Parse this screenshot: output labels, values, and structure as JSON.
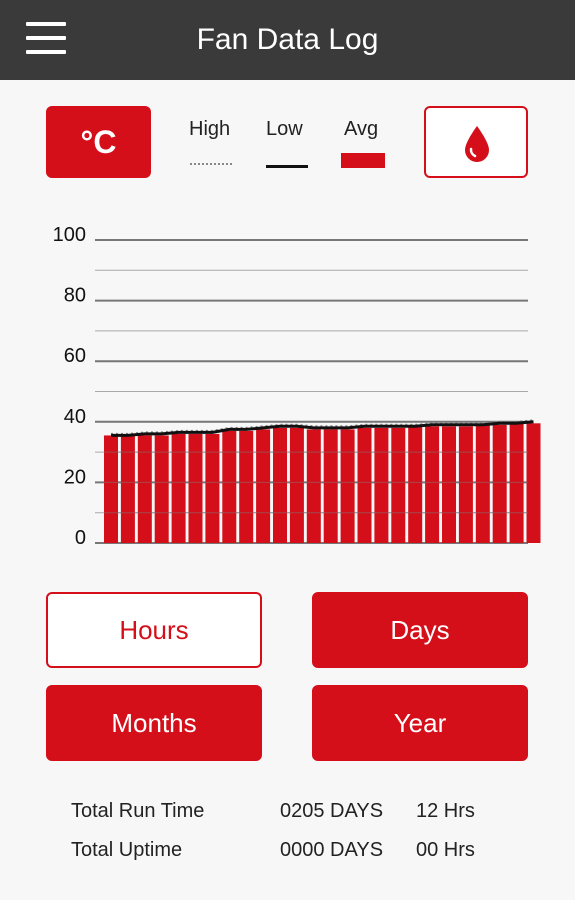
{
  "appbar": {
    "title": "Fan Data Log"
  },
  "controls": {
    "unit_label": "°C",
    "humidity_icon": "water-drop-icon"
  },
  "legend": {
    "high": "High",
    "low": "Low",
    "avg": "Avg"
  },
  "colors": {
    "accent": "#d50f1a",
    "appbar": "#3a3a3a",
    "background": "#f7f7f7"
  },
  "chart_data": {
    "type": "bar",
    "ylim": [
      0,
      100
    ],
    "yticks": [
      0,
      20,
      40,
      60,
      80,
      100
    ],
    "grid": true,
    "series": [
      {
        "name": "Avg",
        "style": "bar",
        "values": [
          35.5,
          35.5,
          35.5,
          35.5,
          36,
          36,
          36,
          37,
          37,
          37.5,
          38,
          38,
          37.5,
          37.5,
          37.5,
          38,
          38,
          38,
          38.5,
          38.5,
          38.5,
          38.5,
          39,
          39,
          39.5,
          39.5
        ]
      },
      {
        "name": "Low",
        "style": "line",
        "values": [
          35.5,
          35.5,
          36,
          36,
          36.5,
          36.5,
          36.5,
          37.5,
          37.5,
          38,
          38.5,
          38.5,
          38,
          38,
          38,
          38.5,
          38.5,
          38.5,
          38.5,
          39,
          39,
          39,
          39,
          39.5,
          39.5,
          40
        ]
      },
      {
        "name": "High",
        "style": "dotted",
        "values": [
          36,
          36,
          36.5,
          36.5,
          37,
          37,
          37,
          38,
          38,
          38.5,
          39,
          39,
          38.5,
          38.5,
          38.5,
          39,
          39,
          39,
          39,
          39.5,
          39.5,
          39.5,
          39.5,
          40,
          40,
          40.5
        ]
      }
    ]
  },
  "range_buttons": {
    "hours": "Hours",
    "days": "Days",
    "months": "Months",
    "year": "Year"
  },
  "stats": {
    "run_time": {
      "label": "Total Run Time",
      "days": "0205 DAYS",
      "hours": "12 Hrs"
    },
    "uptime": {
      "label": "Total Uptime",
      "days": "0000 DAYS",
      "hours": "00 Hrs"
    }
  }
}
